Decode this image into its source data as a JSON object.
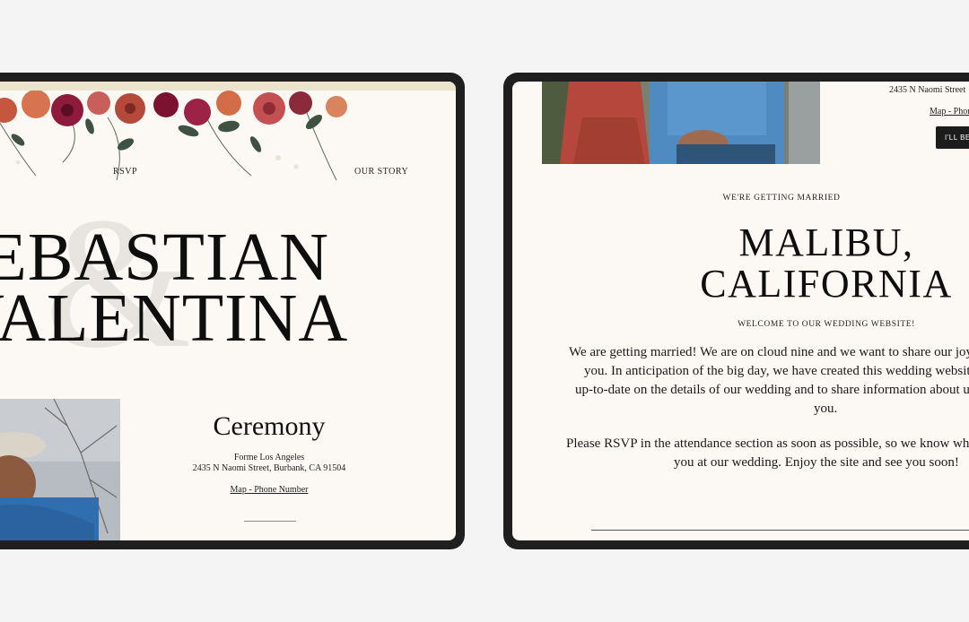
{
  "left_screen": {
    "nav": {
      "rsvp": "RSVP",
      "our_story": "OUR STORY"
    },
    "names": {
      "line1": "SEBASTIAN",
      "line2": "VALENTINA",
      "ampersand": "&"
    },
    "ceremony": {
      "title": "Ceremony",
      "venue": "Forme Los Angeles",
      "address": "2435 N Naomi Street, Burbank, CA 91504",
      "link": "Map - Phone Number"
    }
  },
  "right_screen": {
    "address_partial": "2435 N Naomi Street",
    "link_partial": "Map - Phone",
    "button_label": "I'LL BE THERE",
    "eyebrow": "WE'RE GETTING MARRIED",
    "place": {
      "line1": "MALIBU,",
      "line2": "CALIFORNIA"
    },
    "welcome": "WELCOME TO OUR WEDDING WEBSITE!",
    "paragraph1": [
      "We are getting married! We are on cloud nine and we want to share our joy with",
      "you. In anticipation of the big day, we have created this wedding website to keep you",
      "up-to-date on the details of our wedding and to share information about us with",
      "you."
    ],
    "paragraph2": [
      "Please RSVP in the attendance section as soon as possible, so we know whether to expect",
      "you at our wedding. Enjoy the site and see you soon!"
    ]
  },
  "colors": {
    "background": "#f4f4f4",
    "device_frame": "#1f1f1f",
    "page_background": "#fcf9f5",
    "accent_beige": "#ece3cc",
    "text": "#141414"
  }
}
